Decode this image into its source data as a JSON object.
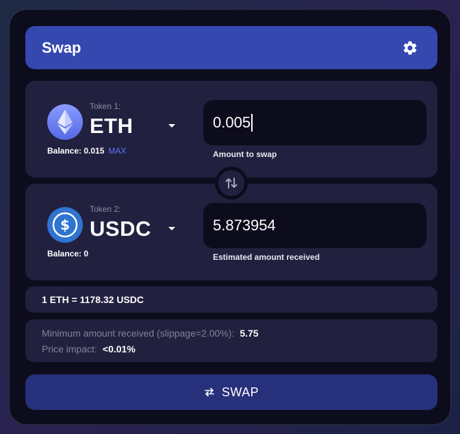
{
  "header": {
    "title": "Swap",
    "settings_icon": "gear-icon"
  },
  "token_in": {
    "caption": "Token 1:",
    "symbol": "ETH",
    "icon": "ethereum-icon",
    "balance_label": "Balance: 0.015",
    "max_label": "MAX",
    "amount": "0.005",
    "amount_caption": "Amount to swap"
  },
  "token_out": {
    "caption": "Token 2:",
    "symbol": "USDC",
    "icon": "usdc-icon",
    "balance_label": "Balance: 0",
    "amount": "5.873954",
    "amount_caption": "Estimated amount received"
  },
  "rate": {
    "text": "1 ETH = 1178.32 USDC"
  },
  "details": {
    "min_received_label": "Minimum amount received (slippage=2.00%):",
    "min_received_value": "5.75",
    "price_impact_label": "Price impact:",
    "price_impact_value": "<0.01%"
  },
  "swap_button": {
    "label": "SWAP",
    "icon": "swap-arrows-icon"
  },
  "colors": {
    "header_bg": "#3448b0",
    "panel_bg": "#22203f",
    "card_bg": "#0d0c1c",
    "accent": "#5b74ff",
    "button_bg": "#27307a"
  }
}
